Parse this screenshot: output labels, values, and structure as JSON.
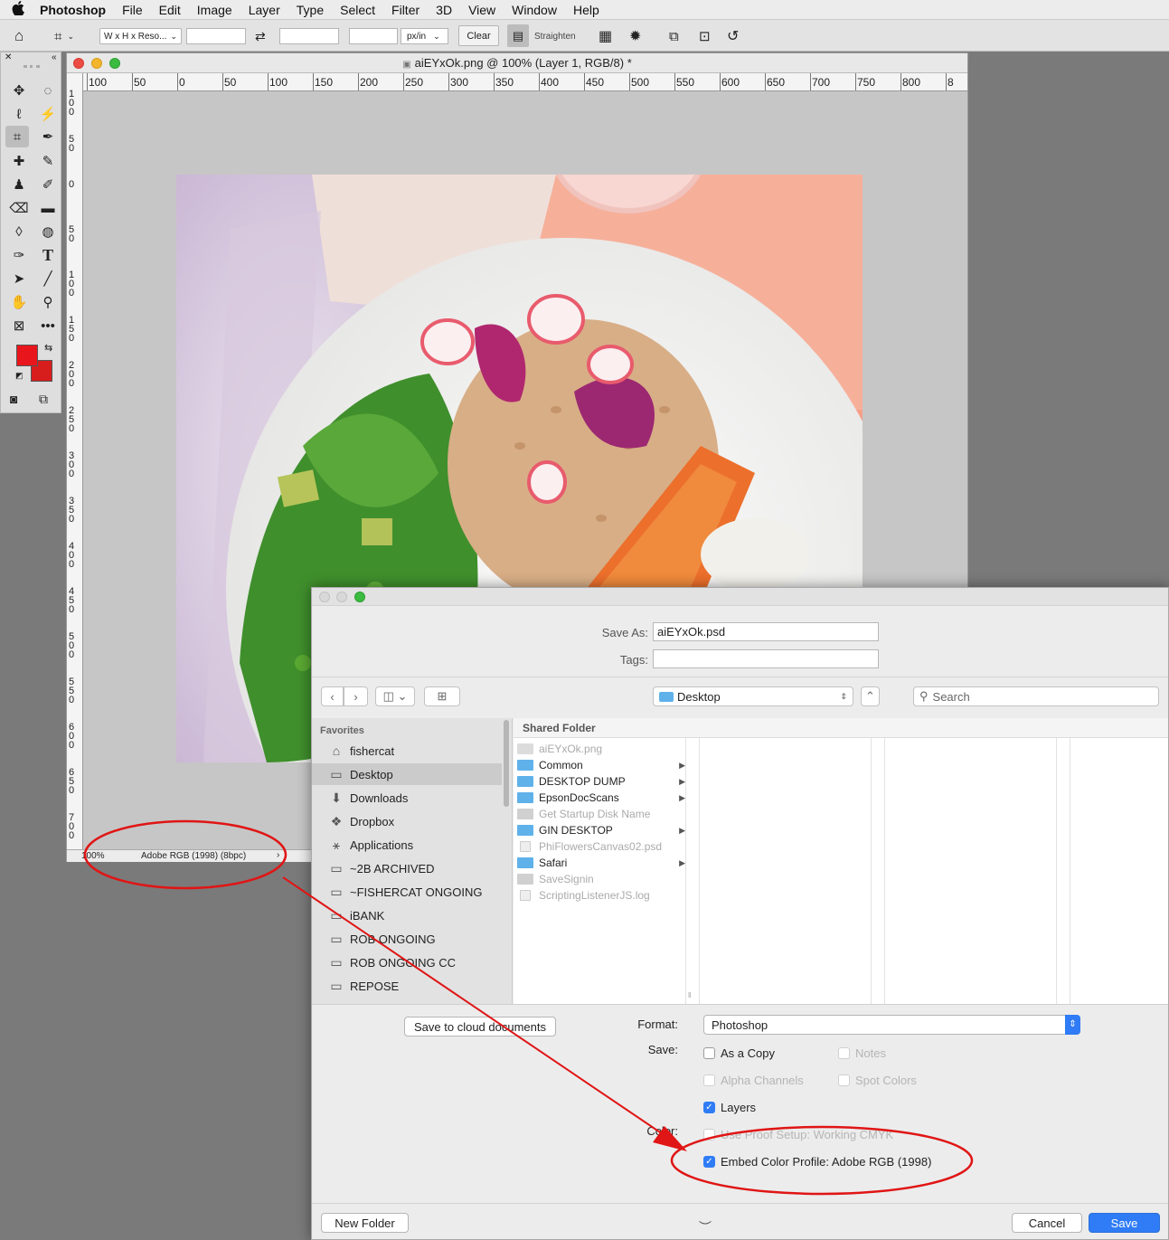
{
  "menubar": {
    "app_name": "Photoshop",
    "items": [
      "File",
      "Edit",
      "Image",
      "Layer",
      "Type",
      "Select",
      "Filter",
      "3D",
      "View",
      "Window",
      "Help"
    ]
  },
  "options_bar": {
    "ratio_preset": "W x H x Reso...",
    "units": "px/in",
    "clear_label": "Clear",
    "straighten_label": "Straighten"
  },
  "document": {
    "title": "aiEYxOk.png @ 100% (Layer 1, RGB/8) *",
    "hruler_labels": [
      "100",
      "50",
      "0",
      "50",
      "100",
      "150",
      "200",
      "250",
      "300",
      "350",
      "400",
      "450",
      "500",
      "550",
      "600",
      "650",
      "700",
      "750",
      "800",
      "8"
    ],
    "vruler_labels": [
      "100",
      "50",
      "0",
      "50",
      "100",
      "150",
      "200",
      "250",
      "300",
      "350",
      "400",
      "450",
      "500",
      "550",
      "600",
      "650",
      "700"
    ],
    "zoom": "100%",
    "profile_status": "Adobe RGB (1998) (8bpc)"
  },
  "save_dialog": {
    "save_as_label": "Save As:",
    "filename": "aiEYxOk.psd",
    "tags_label": "Tags:",
    "location": "Desktop",
    "search_placeholder": "Search",
    "favorites_heading": "Favorites",
    "sidebar_items": [
      {
        "label": "fishercat",
        "icon": "home-icon"
      },
      {
        "label": "Desktop",
        "icon": "desktop-icon"
      },
      {
        "label": "Downloads",
        "icon": "download-icon"
      },
      {
        "label": "Dropbox",
        "icon": "dropbox-icon"
      },
      {
        "label": "Applications",
        "icon": "applications-icon"
      },
      {
        "label": "~2B ARCHIVED",
        "icon": "folder-icon"
      },
      {
        "label": "~FISHERCAT ONGOING",
        "icon": "folder-icon"
      },
      {
        "label": "iBANK",
        "icon": "folder-icon"
      },
      {
        "label": "ROB ONGOING",
        "icon": "folder-icon"
      },
      {
        "label": "ROB ONGOING CC",
        "icon": "folder-icon"
      },
      {
        "label": "REPOSE",
        "icon": "folder-icon"
      }
    ],
    "column_header": "Shared Folder",
    "files": [
      {
        "name": "aiEYxOk.png",
        "kind": "image",
        "enabled": false,
        "folder": false
      },
      {
        "name": "Common",
        "kind": "folder",
        "enabled": true,
        "folder": true
      },
      {
        "name": "DESKTOP DUMP",
        "kind": "alias-folder",
        "enabled": true,
        "folder": true
      },
      {
        "name": "EpsonDocScans",
        "kind": "folder",
        "enabled": true,
        "folder": true
      },
      {
        "name": "Get Startup Disk Name",
        "kind": "app",
        "enabled": false,
        "folder": false
      },
      {
        "name": "GIN DESKTOP",
        "kind": "alias-folder",
        "enabled": true,
        "folder": true
      },
      {
        "name": "PhiFlowersCanvas02.psd",
        "kind": "doc",
        "enabled": false,
        "folder": false
      },
      {
        "name": "Safari",
        "kind": "folder",
        "enabled": true,
        "folder": true
      },
      {
        "name": "SaveSignin",
        "kind": "app",
        "enabled": false,
        "folder": false
      },
      {
        "name": "ScriptingListenerJS.log",
        "kind": "doc",
        "enabled": false,
        "folder": false
      }
    ],
    "cloud_button": "Save to cloud documents",
    "format_label": "Format:",
    "format_value": "Photoshop",
    "save_label": "Save:",
    "options": {
      "as_copy": "As a Copy",
      "notes": "Notes",
      "alpha": "Alpha Channels",
      "spot": "Spot Colors",
      "layers": "Layers"
    },
    "color_label": "Color:",
    "proof_setup": "Use Proof Setup:  Working CMYK",
    "embed_profile": "Embed Color Profile:  Adobe RGB (1998)",
    "new_folder": "New Folder",
    "cancel": "Cancel",
    "save": "Save"
  },
  "colors": {
    "foreground": "#e8161c",
    "background": "#d81d1d",
    "annotation": "#e01515",
    "accent": "#2f7cf6"
  }
}
